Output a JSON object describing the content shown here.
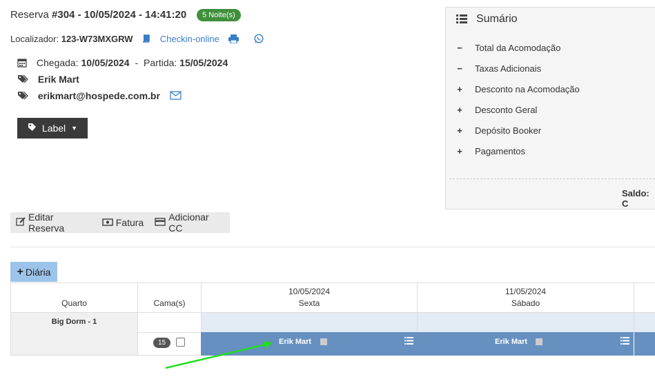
{
  "reservation": {
    "title_prefix": "Reserva ",
    "title_bold": "#304 - 10/05/2024 - 14:41:20",
    "nights_badge": "5 Noite(s)",
    "localizador_label": "Localizador:",
    "localizador_value": "123-W73MXGRW",
    "checkin_link": "Checkin-online",
    "arrival_label": "Chegada:",
    "arrival_date": "10/05/2024",
    "dash": "-",
    "departure_label": "Partida:",
    "departure_date": "15/05/2024",
    "guest_name": "Erik Mart",
    "guest_email": "erikmart@hospede.com.br",
    "label_button": "Label"
  },
  "summary": {
    "title": "Sumário",
    "rows": [
      {
        "sign": "−",
        "label": "Total da Acomodação"
      },
      {
        "sign": "−",
        "label": "Taxas Adicionais"
      },
      {
        "sign": "+",
        "label": "Desconto na Acomodação"
      },
      {
        "sign": "+",
        "label": "Desconto Geral"
      },
      {
        "sign": "+",
        "label": "Depósito Booker"
      },
      {
        "sign": "+",
        "label": "Pagamentos"
      }
    ],
    "saldo_label": "Saldo: C"
  },
  "actions": {
    "edit": "Editar Reserva",
    "invoice": "Fatura",
    "add_cc": "Adicionar CC"
  },
  "diaria_button": "Diária",
  "grid": {
    "col_room": "Quarto",
    "col_beds": "Cama(s)",
    "days": [
      {
        "date": "10/05/2024",
        "weekday": "Sexta"
      },
      {
        "date": "11/05/2024",
        "weekday": "Sábado"
      }
    ],
    "room_name": "Big Dorm - 1",
    "bed_number": "15",
    "bookings": [
      "Erik Mart",
      "Erik Mart"
    ]
  },
  "colors": {
    "badge_green": "#3f8f3b",
    "link_blue": "#3a7dc9",
    "booking_blue": "#6690c0",
    "diaria_blue": "#9cc3ea",
    "arrow_green": "#22dd22"
  }
}
